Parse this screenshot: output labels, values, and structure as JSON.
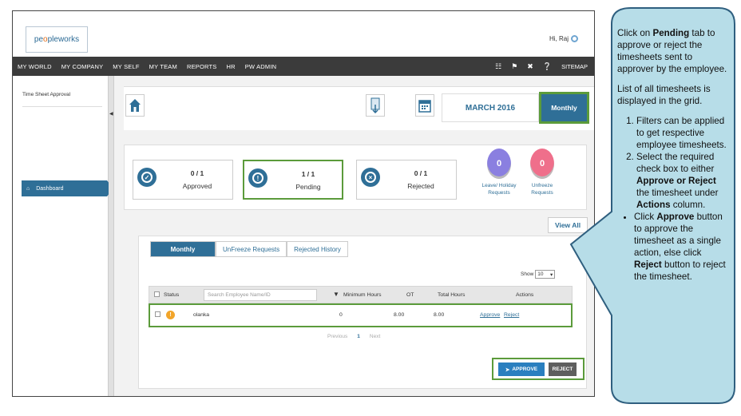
{
  "app": {
    "logo_text_a": "pe",
    "logo_text_o": "o",
    "logo_text_b": "pleworks",
    "greeting": "Hi, Raj"
  },
  "nav": {
    "items": [
      "MY WORLD",
      "MY COMPANY",
      "MY SELF",
      "MY TEAM",
      "REPORTS",
      "HR",
      "PW ADMIN"
    ],
    "right_icons": [
      "book-icon",
      "flag-icon",
      "tools-icon",
      "help-icon"
    ],
    "sitemap": "SITEMAP"
  },
  "sidebar": {
    "title": "Time Sheet Approval",
    "dashboard": "Dashboard"
  },
  "period": {
    "month": "MARCH 2016",
    "view": "Monthly"
  },
  "stats": {
    "approved": {
      "count": "0 / 1",
      "label": "Approved"
    },
    "pending": {
      "count": "1 / 1",
      "label": "Pending"
    },
    "rejected": {
      "count": "0 / 1",
      "label": "Rejected"
    },
    "leave": {
      "count": "0",
      "label_1": "Leave/ Holiday",
      "label_2": "Requests"
    },
    "unfreeze": {
      "count": "0",
      "label_1": "Unfreeze",
      "label_2": "Requests"
    }
  },
  "view_all": "View All",
  "tabs": [
    "Monthly",
    "UnFreeze Requests",
    "Rejected History"
  ],
  "show": {
    "label": "Show",
    "value": "10"
  },
  "table": {
    "headers": {
      "status": "Status",
      "search_placeholder": "Search Employee Name/ID",
      "min_hours": "Minimum Hours",
      "ot": "OT",
      "total": "Total Hours",
      "actions": "Actions"
    },
    "rows": [
      {
        "name": "olanka",
        "min_hours": "0",
        "ot": "8.00",
        "total": "8.00",
        "approve": "Approve",
        "reject": "Reject"
      }
    ]
  },
  "pager": {
    "previous": "Previous",
    "page": "1",
    "next": "Next"
  },
  "buttons": {
    "approve": "APPROVE",
    "reject": "REJECT"
  },
  "callout": {
    "p1_a": "Click on ",
    "p1_b": "Pending",
    "p1_c": " tab to approve or reject the timesheets sent to approver by the employee.",
    "p2": "List of all timesheets is displayed in the grid.",
    "li1": "Filters can be applied to get respective employee timesheets.",
    "li2_a": "Select the required check box to either ",
    "li2_b": "Approve or Reject",
    "li2_c": " the timesheet under ",
    "li2_d": "Actions",
    "li2_e": " column.",
    "li3_a": "Click ",
    "li3_b": "Approve",
    "li3_c": " button to approve the timesheet as a single action, else click ",
    "li3_d": "Reject",
    "li3_e": " button to reject the timesheet."
  }
}
